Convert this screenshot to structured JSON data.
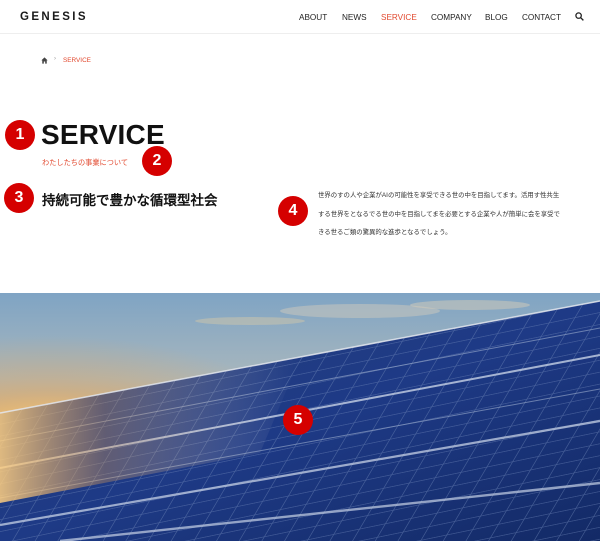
{
  "header": {
    "logo": "GENESIS",
    "nav": [
      "ABOUT",
      "NEWS",
      "SERVICE",
      "COMPANY",
      "BLOG",
      "CONTACT"
    ],
    "active": "SERVICE",
    "accent_color": "#e2492f"
  },
  "breadcrumb": {
    "home_icon": "home-icon",
    "separator": "›",
    "current": "SERVICE"
  },
  "main": {
    "title": "SERVICE",
    "subtitle": "わたしたちの事業について",
    "catch": "持続可能で豊かな循環型社会",
    "description": "世界のすの人や企業がAIの可能性を享受できる世の中を目指してます。活用す性共生する世界をとなるでる世の中を目指してまを必要とする企業や人が簡単に会を享受できる世るご類の驚異的な進歩となるでしょう。"
  },
  "markers": [
    "1",
    "2",
    "3",
    "4",
    "5"
  ],
  "marker_color": "#d50000",
  "hero": {
    "image": "solar-panels-sunset-photo"
  }
}
